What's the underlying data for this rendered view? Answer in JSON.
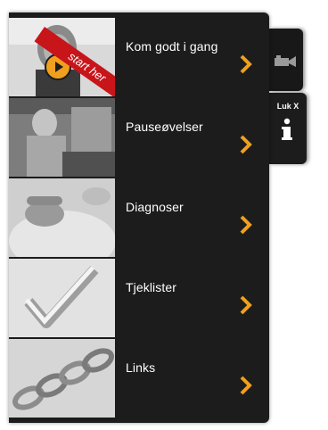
{
  "tabs": {
    "camera_icon": "video-camera-icon",
    "close_label": "Luk X",
    "info_icon": "info-icon"
  },
  "menu": {
    "items": [
      {
        "label": "Kom godt i gang",
        "thumb": "woman-presenter-photo",
        "badge": "start her"
      },
      {
        "label": "Pauseøvelser",
        "thumb": "office-exercise-photo"
      },
      {
        "label": "Diagnoser",
        "thumb": "neck-pain-photo"
      },
      {
        "label": "Tjeklister",
        "thumb": "checkmark-photo"
      },
      {
        "label": "Links",
        "thumb": "chain-links-photo"
      }
    ]
  },
  "colors": {
    "panel": "#1c1c1c",
    "accent_chevron": "#f0a01e",
    "badge": "#c8151a"
  }
}
